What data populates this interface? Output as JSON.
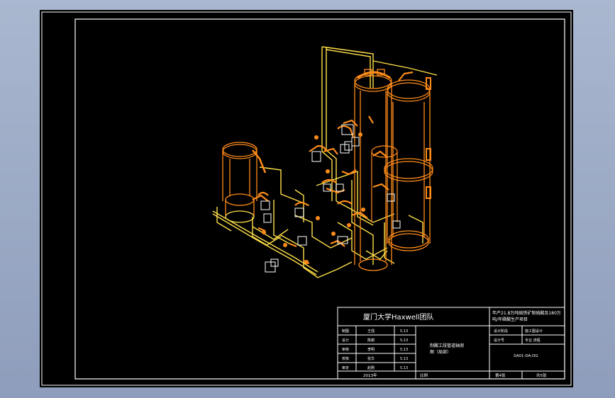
{
  "title_block": {
    "team": "厦门大学Haxwell团队",
    "project_line1": "年产21.8万吨硫铁矿制硫酸及180万",
    "project_line2": "吨/年磷酸生产项目",
    "drawing_name_line1": "制酸工段管道轴测",
    "drawing_name_line2": "图（局部）",
    "drawing_number": "SA01-DA-DG",
    "scale_label": "比例",
    "year": "2013年",
    "sheet": "第4张",
    "total": "共5张",
    "right_rows": [
      {
        "left": "设计阶段",
        "right": "施工图设计"
      },
      {
        "left": "设计号",
        "right": "专业 流程"
      }
    ],
    "rows": [
      {
        "role": "制图",
        "name": "王强",
        "date": "5.13"
      },
      {
        "role": "设计",
        "name": "陈丽",
        "date": "5.13"
      },
      {
        "role": "审核",
        "name": "李明",
        "date": "5.13"
      },
      {
        "role": "校核",
        "name": "张华",
        "date": "5.13"
      },
      {
        "role": "审定",
        "name": "赵刚",
        "date": "5.13"
      }
    ]
  },
  "colors": {
    "background": "#000000",
    "pipe_orange": "#ff8c1a",
    "pipe_yellow": "#ffe04a",
    "frame": "#ffffff",
    "app_bg": "#98a6c2"
  },
  "icons": [
    "vessel-icon",
    "valve-icon",
    "tower-icon",
    "pipe-icon"
  ]
}
